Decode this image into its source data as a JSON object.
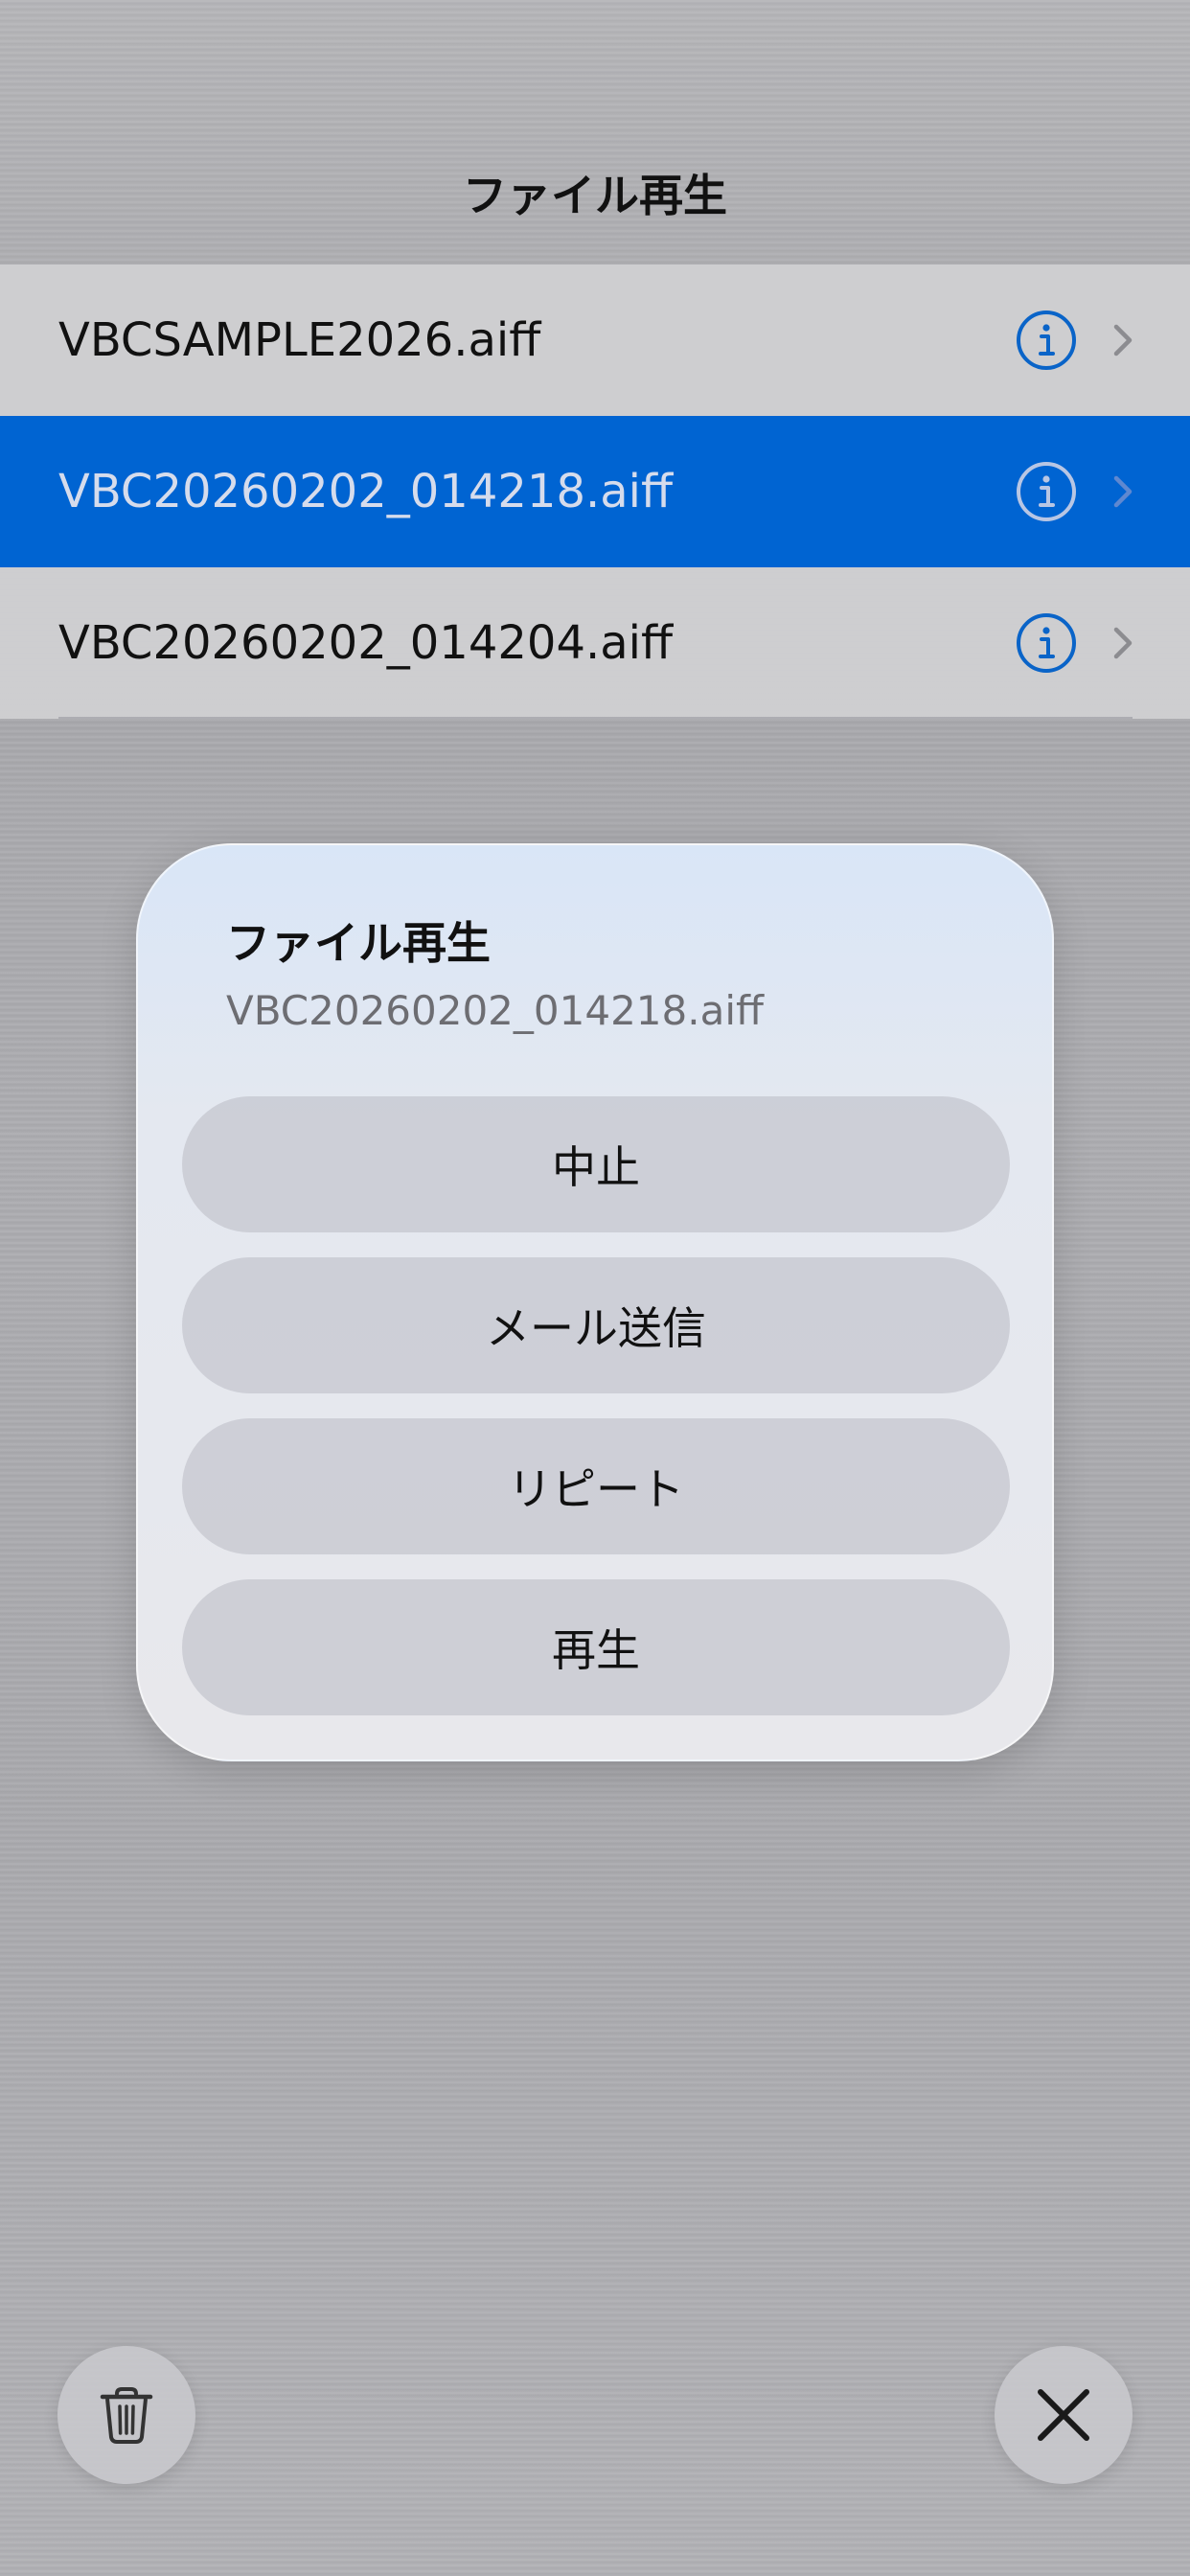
{
  "nav": {
    "title": "ファイル再生"
  },
  "files": [
    {
      "name": "VBCSAMPLE2026.aiff",
      "selected": false
    },
    {
      "name": "VBC20260202_014218.aiff",
      "selected": true
    },
    {
      "name": "VBC20260202_014204.aiff",
      "selected": false
    }
  ],
  "dialog": {
    "title": "ファイル再生",
    "subtitle": "VBC20260202_014218.aiff",
    "buttons": {
      "stop": "中止",
      "send_mail": "メール送信",
      "repeat": "リピート",
      "play": "再生"
    }
  },
  "colors": {
    "accent": "#0064d2",
    "info_icon": "#0a64c8"
  },
  "icons": {
    "row_info": "info-circle-icon",
    "row_chevron": "chevron-right-icon",
    "delete": "trash-icon",
    "close": "close-icon"
  }
}
